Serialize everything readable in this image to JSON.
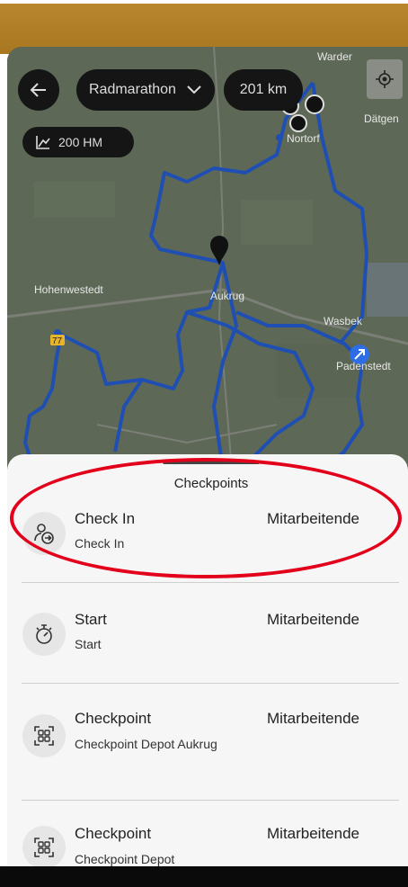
{
  "header": {
    "route_name": "Radmarathon",
    "distance": "201 km",
    "elevation": "200 HM"
  },
  "map": {
    "labels": {
      "warder": "Warder",
      "datgen": "Dätgen",
      "nortorf": "Nortorf",
      "hohenwestedt": "Hohenwestedt",
      "aukrug": "Aukrug",
      "wasbek": "Wasbek",
      "padenstedt": "Padenstedt",
      "road": "77"
    },
    "route_color": "#1f4fb3"
  },
  "sheet": {
    "title": "Checkpoints",
    "items": [
      {
        "title": "Check In",
        "subtitle": "Check In",
        "role": "Mitarbeitende",
        "icon": "person-checkin-icon"
      },
      {
        "title": "Start",
        "subtitle": "Start",
        "role": "Mitarbeitende",
        "icon": "stopwatch-icon"
      },
      {
        "title": "Checkpoint",
        "subtitle": "Checkpoint Depot Aukrug",
        "role": "Mitarbeitende",
        "icon": "qr-scan-icon"
      },
      {
        "title": "Checkpoint",
        "subtitle": "Checkpoint Depot",
        "role": "Mitarbeitende",
        "icon": "qr-scan-icon"
      }
    ]
  },
  "colors": {
    "annotation": "#e3001b",
    "pill_bg": "#151515",
    "sheet_bg": "#f6f6f6"
  }
}
